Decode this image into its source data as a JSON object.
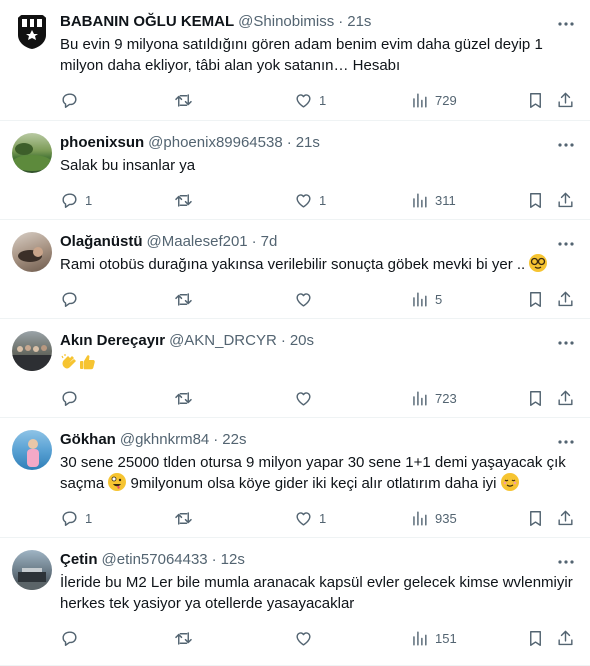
{
  "tweets": [
    {
      "name": "BABANIN OĞLU KEMAL",
      "handle": "@Shinobimiss",
      "time": "21s",
      "text": "Bu evin 9 milyona satıldığını gören adam benim evim daha güzel deyip 1 milyon daha ekliyor, tâbi alan yok satanın… Hesabı",
      "replies": "",
      "retweets": "",
      "likes": "1",
      "views": "729",
      "avatar": "besiktas-logo"
    },
    {
      "name": "phoenixsun",
      "handle": "@phoenix89964538",
      "time": "21s",
      "text": "Salak bu insanlar ya",
      "replies": "1",
      "retweets": "",
      "likes": "1",
      "views": "311",
      "avatar": "landscape-photo"
    },
    {
      "name": "Olağanüstü",
      "handle": "@Maalesef201",
      "time": "7d",
      "text": "Rami otobüs durağına yakınsa verilebilir sonuçta göbek mevki bi yer ..",
      "replies": "",
      "retweets": "",
      "likes": "",
      "views": "5",
      "avatar": "person-photo"
    },
    {
      "name": "Akın Dereçayır",
      "handle": "@AKN_DRCYR",
      "time": "20s",
      "text": "",
      "replies": "",
      "retweets": "",
      "likes": "",
      "views": "723",
      "avatar": "crowd-photo"
    },
    {
      "name": "Gökhan",
      "handle": "@gkhnkrm84",
      "time": "22s",
      "text": "30 sene 25000 tlden otursa 9 milyon yapar 30 sene 1+1 demi yaşayacak çık saçma",
      "text2": "9milyonum olsa köye gider iki keçi alır otlatırım daha iyi",
      "replies": "1",
      "retweets": "",
      "likes": "1",
      "views": "935",
      "avatar": "beach-photo"
    },
    {
      "name": "Çetin",
      "handle": "@etin57064433",
      "time": "12s",
      "text": "İleride bu M2 Ler bile mumla aranacak kapsül evler gelecek kimse wvlenmiyir herkes tek yasiyor ya otellerde yasayacaklar",
      "replies": "",
      "retweets": "",
      "likes": "",
      "views": "151",
      "avatar": "house-photo"
    }
  ],
  "colors": {
    "text": "#0f1419",
    "secondary": "#536471",
    "divider": "#eff3f4"
  },
  "icons": [
    "more-icon",
    "reply-icon",
    "retweet-icon",
    "like-icon",
    "views-icon",
    "bookmark-icon",
    "share-icon"
  ]
}
